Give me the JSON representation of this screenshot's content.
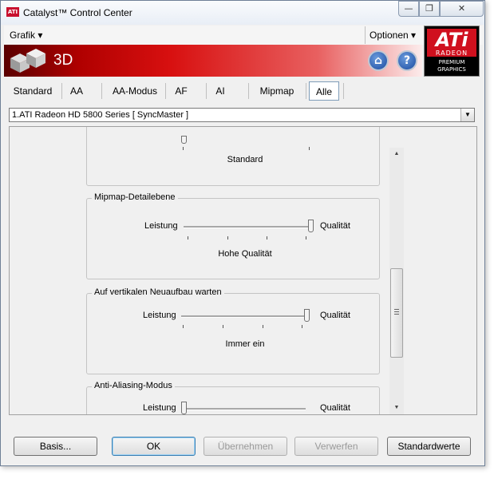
{
  "window": {
    "title": "Catalyst™ Control Center",
    "app_icon_text": "ATI",
    "min_glyph": "—",
    "max_glyph": "❐",
    "close_glyph": "✕"
  },
  "menubar": {
    "grafik": "Grafik ▾",
    "optionen": "Optionen ▾"
  },
  "banner": {
    "title": "3D",
    "home_glyph": "⌂",
    "help_glyph": "?",
    "logo_ati": "ATi",
    "logo_radeon": "RADEON",
    "logo_premium": "PREMIUM",
    "logo_graphics": "GRAPHICS"
  },
  "tabs": [
    {
      "label": "Standard"
    },
    {
      "label": "AA"
    },
    {
      "label": "AA-Modus"
    },
    {
      "label": "AF"
    },
    {
      "label": "AI"
    },
    {
      "label": "Mipmap"
    },
    {
      "label": "Alle",
      "active": true
    }
  ],
  "adapter": {
    "selected": "1.ATI Radeon HD 5800 Series [ SyncMaster ]",
    "arrow": "▼"
  },
  "groups": {
    "standard": {
      "value_text": "Standard"
    },
    "mipmap": {
      "title": "Mipmap-Detailebene",
      "left_label": "Leistung",
      "right_label": "Qualität",
      "value_text": "Hohe Qualität",
      "level": 1.0
    },
    "vsync": {
      "title": "Auf vertikalen Neuaufbau warten",
      "left_label": "Leistung",
      "right_label": "Qualität",
      "value_text": "Immer ein",
      "level": 1.0
    },
    "aa_mode": {
      "title": "Anti-Aliasing-Modus",
      "left_label": "Leistung",
      "right_label": "Qualität",
      "level": 0.0
    }
  },
  "scrollbar": {
    "up": "▲",
    "down": "▼"
  },
  "buttons": {
    "basis": "Basis...",
    "ok": "OK",
    "apply": "Übernehmen",
    "discard": "Verwerfen",
    "defaults": "Standardwerte"
  }
}
